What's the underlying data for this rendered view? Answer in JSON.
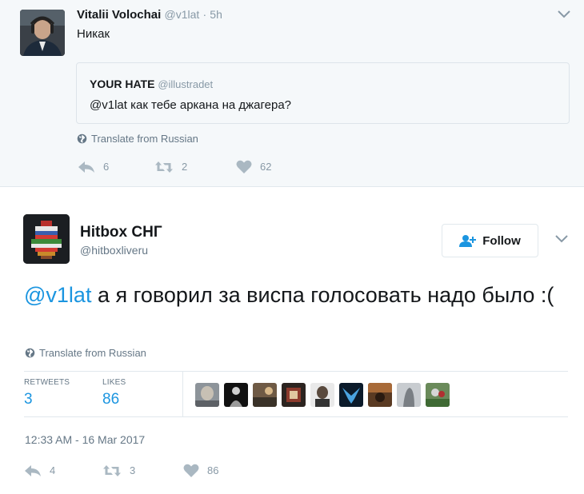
{
  "parent_tweet": {
    "author_name": "Vitalii Volochai",
    "author_handle": "@v1lat",
    "separator": "·",
    "time": "5h",
    "text": "Никак",
    "quote": {
      "author_name": "YOUR HATE",
      "author_handle": "@illustradet",
      "text": "@v1lat как тебе аркана на джагера?"
    },
    "translate": "Translate from Russian",
    "reply_count": "6",
    "retweet_count": "2",
    "like_count": "62"
  },
  "main_tweet": {
    "author_name": "Hitbox СНГ",
    "author_handle": "@hitboxliveru",
    "follow_label": "Follow",
    "mention": "@v1lat",
    "text": " а я говорил за виспа голосовать надо было :(",
    "translate": "Translate from Russian",
    "retweets_label": "RETWEETS",
    "retweets_value": "3",
    "likes_label": "LIKES",
    "likes_value": "86",
    "liker_avatar_count": 9,
    "timestamp": "12:33 AM - 16 Mar 2017",
    "reply_count": "4",
    "retweet_count": "3",
    "like_count": "86"
  },
  "colors": {
    "link_blue": "#1b95e0",
    "muted_gray": "#8899a6",
    "parent_background": "#f5f8fa"
  },
  "icons": [
    "chevron-down-icon",
    "globe-icon",
    "reply-icon",
    "retweet-icon",
    "heart-icon",
    "follow-user-icon"
  ]
}
